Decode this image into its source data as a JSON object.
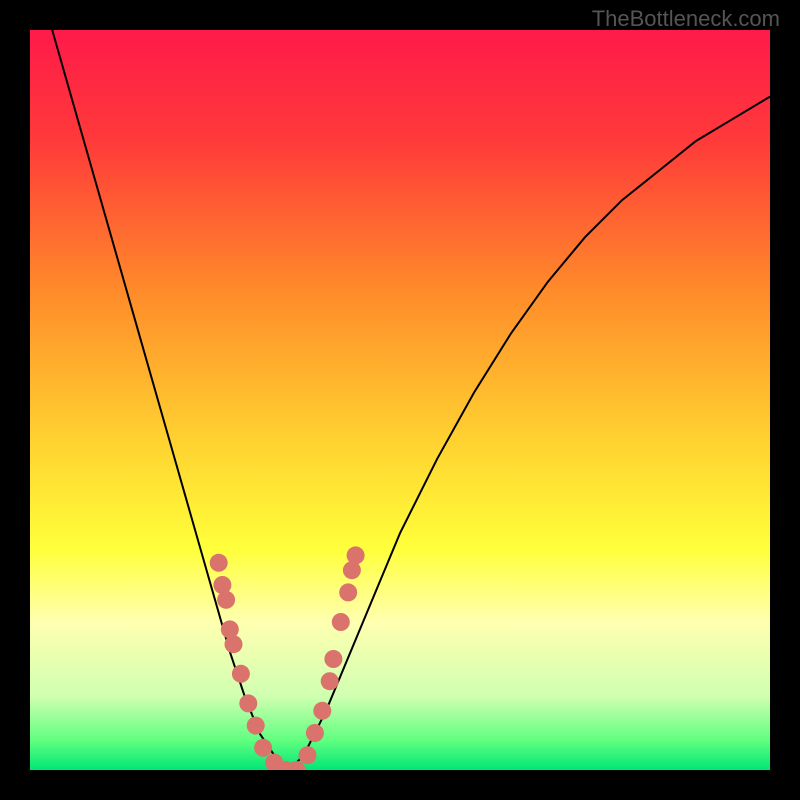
{
  "watermark": "TheBottleneck.com",
  "chart_data": {
    "type": "line",
    "title": "",
    "xlabel": "",
    "ylabel": "",
    "xlim": [
      0,
      100
    ],
    "ylim": [
      0,
      100
    ],
    "background_gradient": {
      "stops": [
        {
          "offset": 0,
          "color": "#ff1a4a"
        },
        {
          "offset": 15,
          "color": "#ff3a3a"
        },
        {
          "offset": 35,
          "color": "#ff8a2a"
        },
        {
          "offset": 55,
          "color": "#ffd030"
        },
        {
          "offset": 70,
          "color": "#ffff3a"
        },
        {
          "offset": 80,
          "color": "#ffffb0"
        },
        {
          "offset": 90,
          "color": "#d0ffb0"
        },
        {
          "offset": 96,
          "color": "#60ff80"
        },
        {
          "offset": 100,
          "color": "#00e676"
        }
      ]
    },
    "series": [
      {
        "name": "bottleneck-curve",
        "color": "#000000",
        "x": [
          3,
          5,
          7,
          9,
          11,
          13,
          15,
          17,
          19,
          21,
          23,
          25,
          27,
          29,
          31,
          33,
          35,
          37,
          40,
          45,
          50,
          55,
          60,
          65,
          70,
          75,
          80,
          85,
          90,
          95,
          100
        ],
        "y": [
          100,
          93,
          86,
          79,
          72,
          65,
          58,
          51,
          44,
          37,
          30,
          23,
          16,
          10,
          5,
          2,
          0,
          2,
          8,
          20,
          32,
          42,
          51,
          59,
          66,
          72,
          77,
          81,
          85,
          88,
          91
        ]
      }
    ],
    "scatter_points": {
      "name": "highlight-points",
      "color": "#d9736b",
      "points": [
        {
          "x": 25.5,
          "y": 28
        },
        {
          "x": 26,
          "y": 25
        },
        {
          "x": 26.5,
          "y": 23
        },
        {
          "x": 27,
          "y": 19
        },
        {
          "x": 27.5,
          "y": 17
        },
        {
          "x": 28.5,
          "y": 13
        },
        {
          "x": 29.5,
          "y": 9
        },
        {
          "x": 30.5,
          "y": 6
        },
        {
          "x": 31.5,
          "y": 3
        },
        {
          "x": 33,
          "y": 1
        },
        {
          "x": 34.5,
          "y": 0
        },
        {
          "x": 36,
          "y": 0
        },
        {
          "x": 37.5,
          "y": 2
        },
        {
          "x": 38.5,
          "y": 5
        },
        {
          "x": 39.5,
          "y": 8
        },
        {
          "x": 40.5,
          "y": 12
        },
        {
          "x": 41,
          "y": 15
        },
        {
          "x": 42,
          "y": 20
        },
        {
          "x": 43,
          "y": 24
        },
        {
          "x": 43.5,
          "y": 27
        },
        {
          "x": 44,
          "y": 29
        }
      ]
    }
  }
}
